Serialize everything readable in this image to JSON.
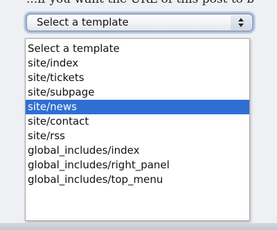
{
  "background_text": "...if you want the URL of this post to b",
  "select": {
    "value": "Select a template",
    "arrows_icon": "up-down-arrows-icon"
  },
  "dropdown": {
    "options": [
      "Select a template",
      "site/index",
      "site/tickets",
      "site/subpage",
      "site/news",
      "site/contact",
      "site/rss",
      "global_includes/index",
      "global_includes/right_panel",
      "global_includes/top_menu"
    ],
    "highlighted": "site/news"
  },
  "colors": {
    "highlight": "#2f6fd3",
    "focus_ring": "#9fb6d8"
  }
}
